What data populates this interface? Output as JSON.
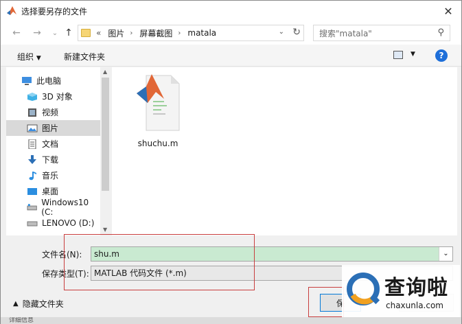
{
  "window": {
    "title": "选择要另存的文件",
    "close_glyph": "✕"
  },
  "nav": {
    "back_glyph": "←",
    "forward_glyph": "→",
    "history_glyph": "⌄",
    "up_glyph": "↑",
    "breadcrumb_prefix": "«",
    "breadcrumb": [
      "图片",
      "屏幕截图",
      "matala"
    ],
    "search_placeholder": "搜索\"matala\""
  },
  "toolbar": {
    "organize_label": "组织",
    "new_folder_label": "新建文件夹"
  },
  "sidebar": {
    "items": [
      {
        "label": "此电脑",
        "icon": "computer-icon"
      },
      {
        "label": "3D 对象",
        "icon": "cube-icon"
      },
      {
        "label": "视频",
        "icon": "video-icon"
      },
      {
        "label": "图片",
        "icon": "picture-icon"
      },
      {
        "label": "文档",
        "icon": "document-icon"
      },
      {
        "label": "下载",
        "icon": "download-icon"
      },
      {
        "label": "音乐",
        "icon": "music-icon"
      },
      {
        "label": "桌面",
        "icon": "desktop-icon"
      },
      {
        "label": "Windows10 (C:",
        "icon": "drive-icon"
      },
      {
        "label": "LENOVO (D:)",
        "icon": "drive-icon"
      }
    ]
  },
  "files": [
    {
      "name": "shuchu.m",
      "icon": "matlab-file-icon"
    }
  ],
  "form": {
    "filename_label": "文件名(N):",
    "filename_value": "shu.m",
    "filetype_label": "保存类型(T):",
    "filetype_value": "MATLAB 代码文件 (*.m)"
  },
  "footer": {
    "hide_folders_label": "隐藏文件夹",
    "save_label": "保"
  },
  "watermark": {
    "title": "查询啦",
    "url": "chaxunla.com"
  },
  "bottom_strip": "详细信息",
  "colors": {
    "accent": "#0078d7",
    "filename_highlight": "#c9ead1",
    "annotation_red": "#c83c3c"
  }
}
